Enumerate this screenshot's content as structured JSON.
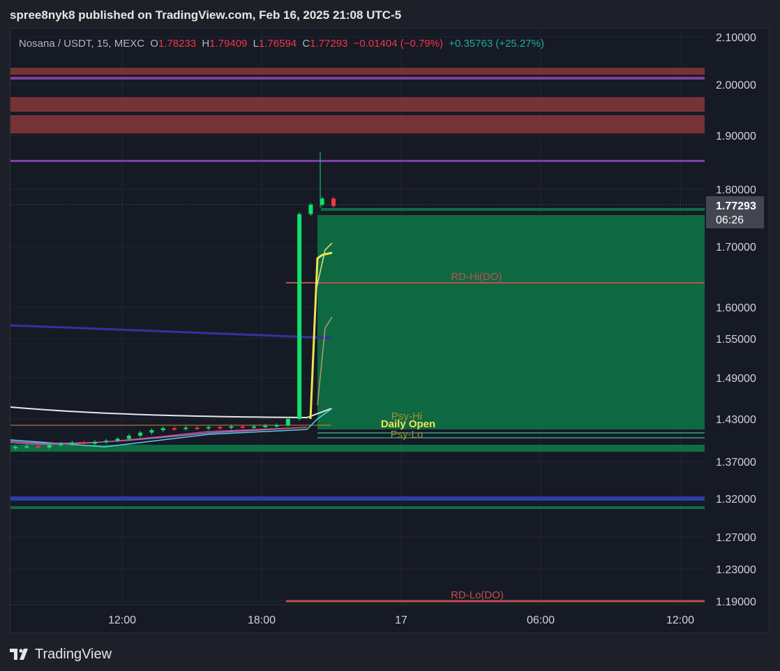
{
  "header": {
    "published_text": "spree8nyk8 published on TradingView.com, Feb 16, 2025 21:08 UTC-5"
  },
  "legend": {
    "symbol": "Nosana / USDT, 15, MEXC",
    "o_label": "O",
    "o_value": "1.78233",
    "h_label": "H",
    "h_value": "1.79409",
    "l_label": "L",
    "l_value": "1.76594",
    "c_label": "C",
    "c_value": "1.77293",
    "change": "−0.01404 (−0.79%)",
    "change2": "+0.35763 (+25.27%)"
  },
  "price_tag": {
    "price": "1.77293",
    "countdown": "06:26"
  },
  "footer": {
    "brand": "TradingView"
  },
  "colors": {
    "up": "#0ee26d",
    "down": "#f23645",
    "zone_red": "#7a3536",
    "zone_green": "#0e6e45",
    "purple": "#7e3fa3",
    "blue": "#2f3ca8"
  },
  "chart_data": {
    "type": "candlestick",
    "symbol": "Nosana / USDT",
    "interval": "15",
    "exchange": "MEXC",
    "y_ticks": [
      "2.10000",
      "2.00000",
      "1.90000",
      "1.80000",
      "1.70000",
      "1.60000",
      "1.55000",
      "1.49000",
      "1.43000",
      "1.37000",
      "1.32000",
      "1.27000",
      "1.23000",
      "1.19000"
    ],
    "x_ticks": [
      "12:00",
      "18:00",
      "17",
      "06:00",
      "12:00"
    ],
    "annotations": [
      "RD-Hi(DO)",
      "Psy-Hi",
      "Daily Open",
      "Psy-Lo",
      "RD-Lo(DO)"
    ],
    "ohlc_last": {
      "open": 1.78233,
      "high": 1.79409,
      "low": 1.76594,
      "close": 1.77293
    },
    "candles_approx_close": [
      1.385,
      1.386,
      1.384,
      1.388,
      1.39,
      1.392,
      1.39,
      1.393,
      1.395,
      1.398,
      1.403,
      1.408,
      1.412,
      1.415,
      1.414,
      1.416,
      1.415,
      1.417,
      1.416,
      1.418,
      1.417,
      1.418,
      1.419,
      1.42,
      1.43,
      1.76,
      1.775,
      1.785,
      1.773
    ]
  }
}
